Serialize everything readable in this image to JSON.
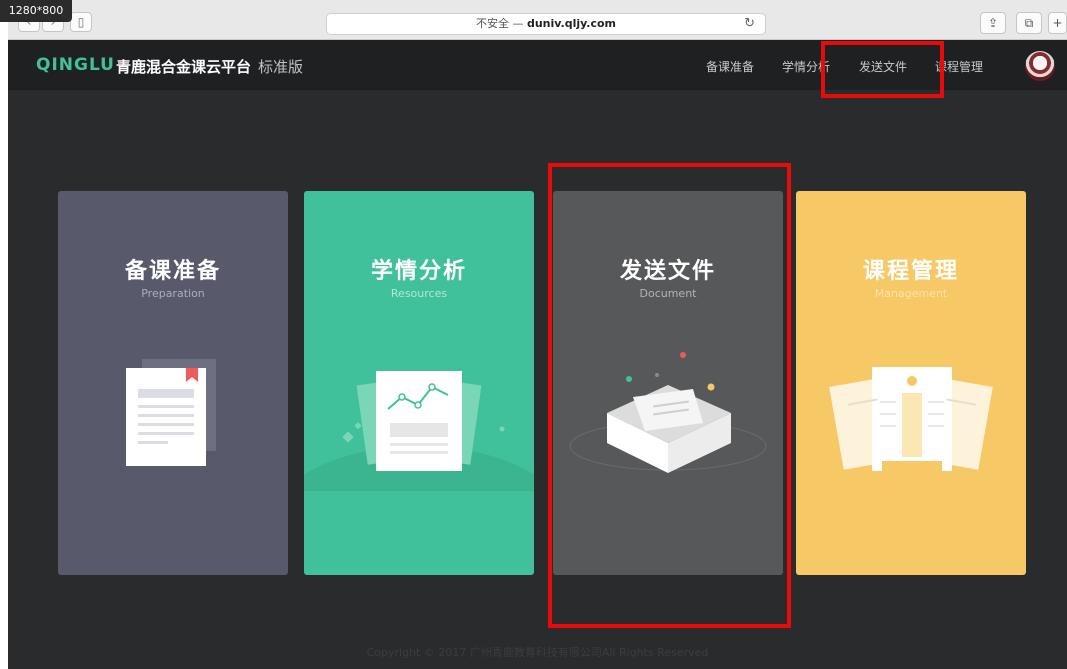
{
  "screen_badge": "1280*800",
  "browser": {
    "insecure_label": "不安全 —",
    "domain": "duniv.qljy.com"
  },
  "app": {
    "logo": "QINGLU",
    "brand": "青鹿混合金课云平台",
    "edition": "标准版",
    "nav": [
      "备课准备",
      "学情分析",
      "发送文件",
      "课程管理"
    ]
  },
  "cards": [
    {
      "title": "备课准备",
      "subtitle": "Preparation",
      "color": "#585a6b"
    },
    {
      "title": "学情分析",
      "subtitle": "Resources",
      "color": "#40c19b"
    },
    {
      "title": "发送文件",
      "subtitle": "Document",
      "color": "#575859"
    },
    {
      "title": "课程管理",
      "subtitle": "Management",
      "color": "#f6c866"
    }
  ],
  "footer": "Copyright © 2017 广州青鹿教育科技有限公司All Rights Reserved",
  "highlight_color": "#e80b0b"
}
